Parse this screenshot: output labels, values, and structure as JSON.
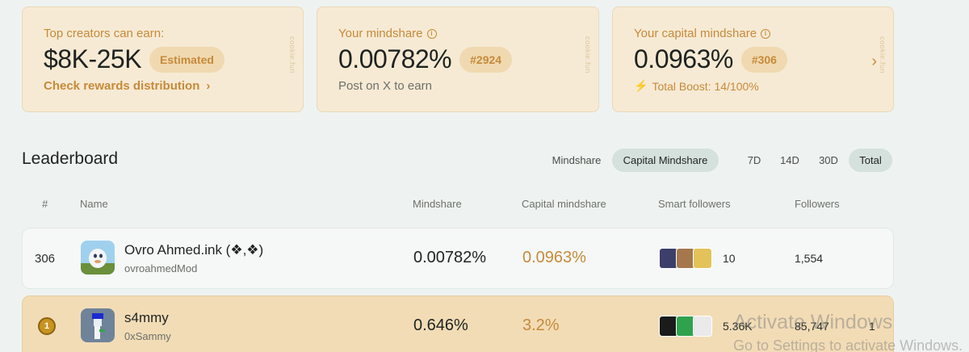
{
  "cards": {
    "earn": {
      "label": "Top creators can earn:",
      "amount": "$8K-25K",
      "badge": "Estimated",
      "link": "Check rewards distribution",
      "watermark": "cookie.fun"
    },
    "mindshare": {
      "label": "Your mindshare",
      "value": "0.00782%",
      "rank": "#2924",
      "sub": "Post on X to earn",
      "watermark": "cookie.fun"
    },
    "capital": {
      "label": "Your capital mindshare",
      "value": "0.0963%",
      "rank": "#306",
      "boost": "Total Boost: 14/100%",
      "watermark": "cookie.fun"
    }
  },
  "leaderboard": {
    "title": "Leaderboard",
    "metric_tabs": [
      "Mindshare",
      "Capital Mindshare"
    ],
    "active_metric": "Capital Mindshare",
    "period_tabs": [
      "7D",
      "14D",
      "30D",
      "Total"
    ],
    "active_period": "Total",
    "columns": [
      "#",
      "Name",
      "Mindshare",
      "Capital mindshare",
      "Smart followers",
      "Followers"
    ],
    "rows": [
      {
        "rank": "306",
        "name": "Ovro Ahmed.ink (❖,❖)",
        "handle": "ovroahmedMod",
        "mindshare": "0.00782%",
        "capital_mindshare": "0.0963%",
        "smart_followers": "10",
        "followers": "1,554"
      },
      {
        "rank": "1",
        "name": "s4mmy",
        "handle": "0xSammy",
        "mindshare": "0.646%",
        "capital_mindshare": "3.2%",
        "smart_followers": "5.36K",
        "followers": "85,747",
        "trailing": "1"
      }
    ]
  },
  "os_watermark": {
    "line1": "Activate Windows",
    "line2": "Go to Settings to activate Windows."
  },
  "colors": {
    "accent": "#c68a3a",
    "card_bg": "#f6ead4",
    "page_bg": "#eef3f1",
    "highlight_row": "#f2dcb6"
  }
}
